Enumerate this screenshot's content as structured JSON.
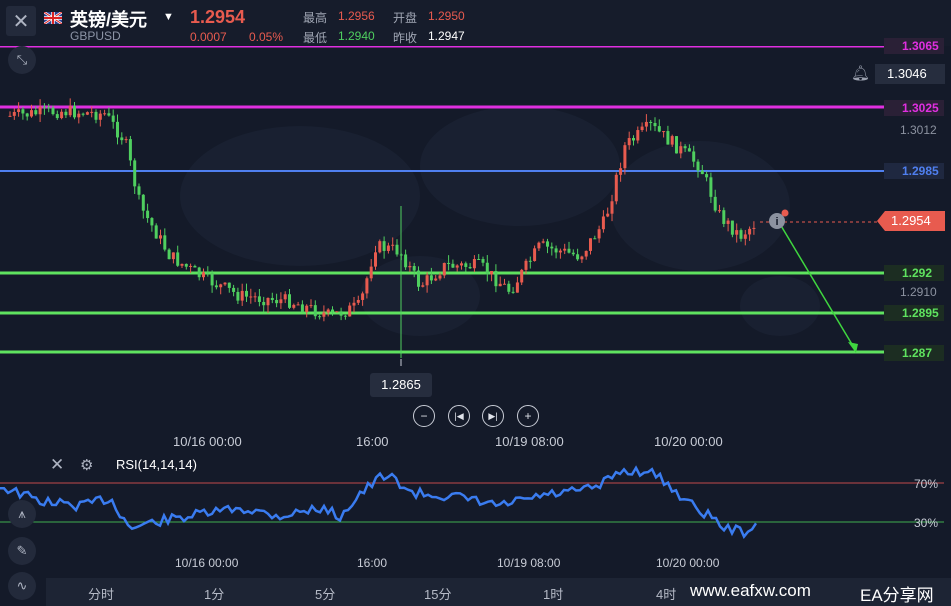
{
  "header": {
    "title": "英镑/美元",
    "symbol": "GBPUSD",
    "price": "1.2954",
    "change": "0.0007",
    "change_pct": "0.05%",
    "high_label": "最高",
    "high": "1.2956",
    "open_label": "开盘",
    "open": "1.2950",
    "low_label": "最低",
    "low": "1.2940",
    "prev_close_label": "昨收",
    "prev_close": "1.2947"
  },
  "price_tags": {
    "r1": "1.3065",
    "cursor": "1.3046",
    "r2": "1.3025",
    "grid1": "1.3012",
    "r3": "1.2985",
    "current": "1.2954",
    "s1": "1.292",
    "grid2": "1.2910",
    "s2": "1.2895",
    "s3": "1.287"
  },
  "low_marker": "1.2865",
  "time_axis": [
    "10/16 00:00",
    "16:00",
    "10/19 08:00",
    "10/20 00:00"
  ],
  "rsi": {
    "label": "RSI(14,14,14)",
    "upper": "70%",
    "lower": "30%"
  },
  "timeframes": [
    "分时",
    "1分",
    "5分",
    "15分",
    "1时",
    "4时"
  ],
  "watermark": "www.eafxw.com",
  "brand": "EA分享网",
  "colors": {
    "magenta": "#e02fe0",
    "blue": "#4f7fef",
    "green": "#5fe35f",
    "up": "#e85b4f",
    "down": "#4fcf5f"
  }
}
